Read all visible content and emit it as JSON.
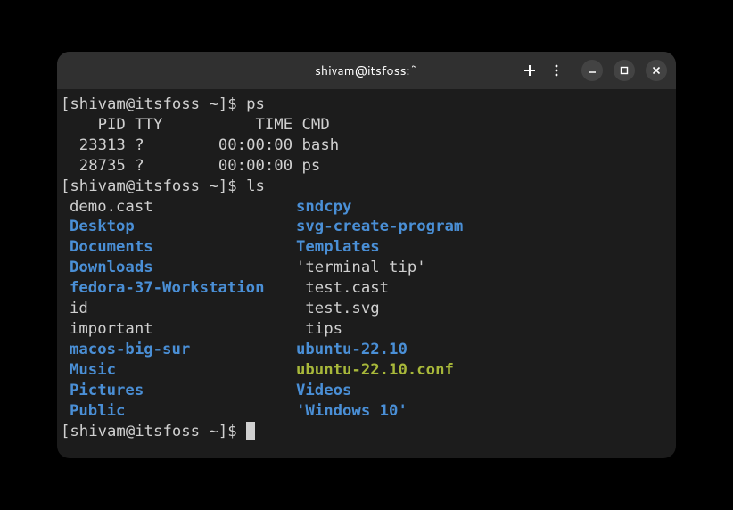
{
  "titlebar": {
    "title": "shivam@itsfoss:~"
  },
  "prompt": {
    "p1_open": "[",
    "p1_user": "shivam@itsfoss ~",
    "p1_close": "]$ ",
    "cmd1": "ps",
    "cmd2": "ls"
  },
  "ps": {
    "header": "    PID TTY          TIME CMD",
    "row1": "  23313 ?        00:00:00 bash",
    "row2": "  28735 ?        00:00:00 ps"
  },
  "ls": {
    "rows": [
      {
        "c1": "demo.cast",
        "c1t": "reg",
        "c2": "sndcpy",
        "c2t": "dir"
      },
      {
        "c1": "Desktop",
        "c1t": "dir",
        "c2": "svg-create-program",
        "c2t": "dir"
      },
      {
        "c1": "Documents",
        "c1t": "dir",
        "c2": "Templates",
        "c2t": "dir"
      },
      {
        "c1": "Downloads",
        "c1t": "dir",
        "c2": "'terminal tip'",
        "c2t": "reg"
      },
      {
        "c1": "fedora-37-Workstation",
        "c1t": "dir",
        "c2": " test.cast",
        "c2t": "reg"
      },
      {
        "c1": "id",
        "c1t": "reg",
        "c2": " test.svg",
        "c2t": "reg"
      },
      {
        "c1": "important",
        "c1t": "reg",
        "c2": " tips",
        "c2t": "reg"
      },
      {
        "c1": "macos-big-sur",
        "c1t": "dir",
        "c2": "ubuntu-22.10",
        "c2t": "dir"
      },
      {
        "c1": "Music",
        "c1t": "dir",
        "c2": "ubuntu-22.10.conf",
        "c2t": "exec"
      },
      {
        "c1": "Pictures",
        "c1t": "dir",
        "c2": "Videos",
        "c2t": "dir"
      },
      {
        "c1": "Public",
        "c1t": "dir",
        "c2": "'Windows 10'",
        "c2t": "dir"
      }
    ]
  }
}
